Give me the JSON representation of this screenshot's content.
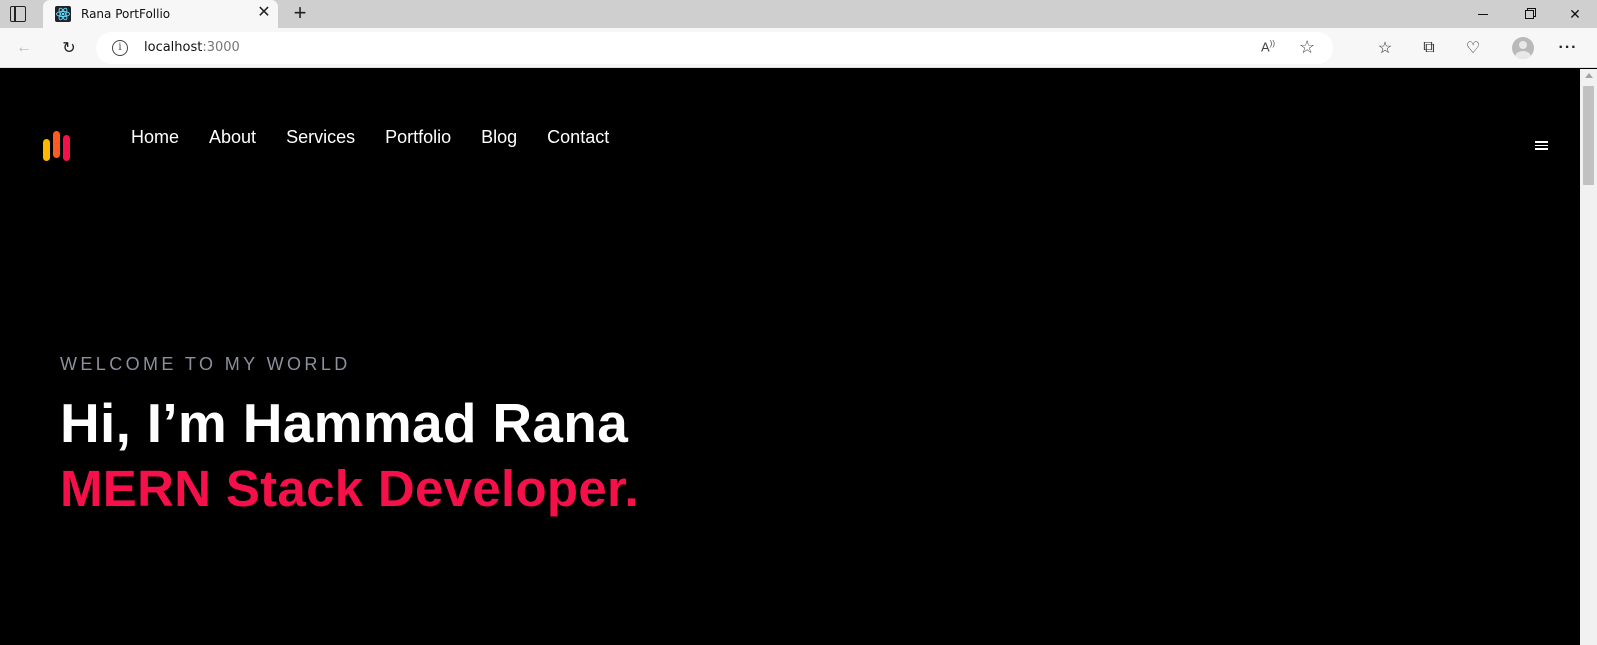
{
  "browser": {
    "tab": {
      "title": "Rana PortFollio"
    },
    "address": {
      "host": "localhost",
      "port": ":3000"
    }
  },
  "page": {
    "nav": {
      "items": [
        {
          "label": "Home"
        },
        {
          "label": "About"
        },
        {
          "label": "Services"
        },
        {
          "label": "Portfolio"
        },
        {
          "label": "Blog"
        },
        {
          "label": "Contact"
        }
      ]
    },
    "hero": {
      "welcome": "WELCOME TO MY WORLD",
      "title": "Hi, I’m Hammad Rana",
      "role": "MERN Stack Developer."
    },
    "colors": {
      "background": "#000000",
      "accent": "#f5104a",
      "muted": "#8b8f9e",
      "logo": [
        "#ffb800",
        "#ff5a1f",
        "#f5104a"
      ]
    }
  }
}
